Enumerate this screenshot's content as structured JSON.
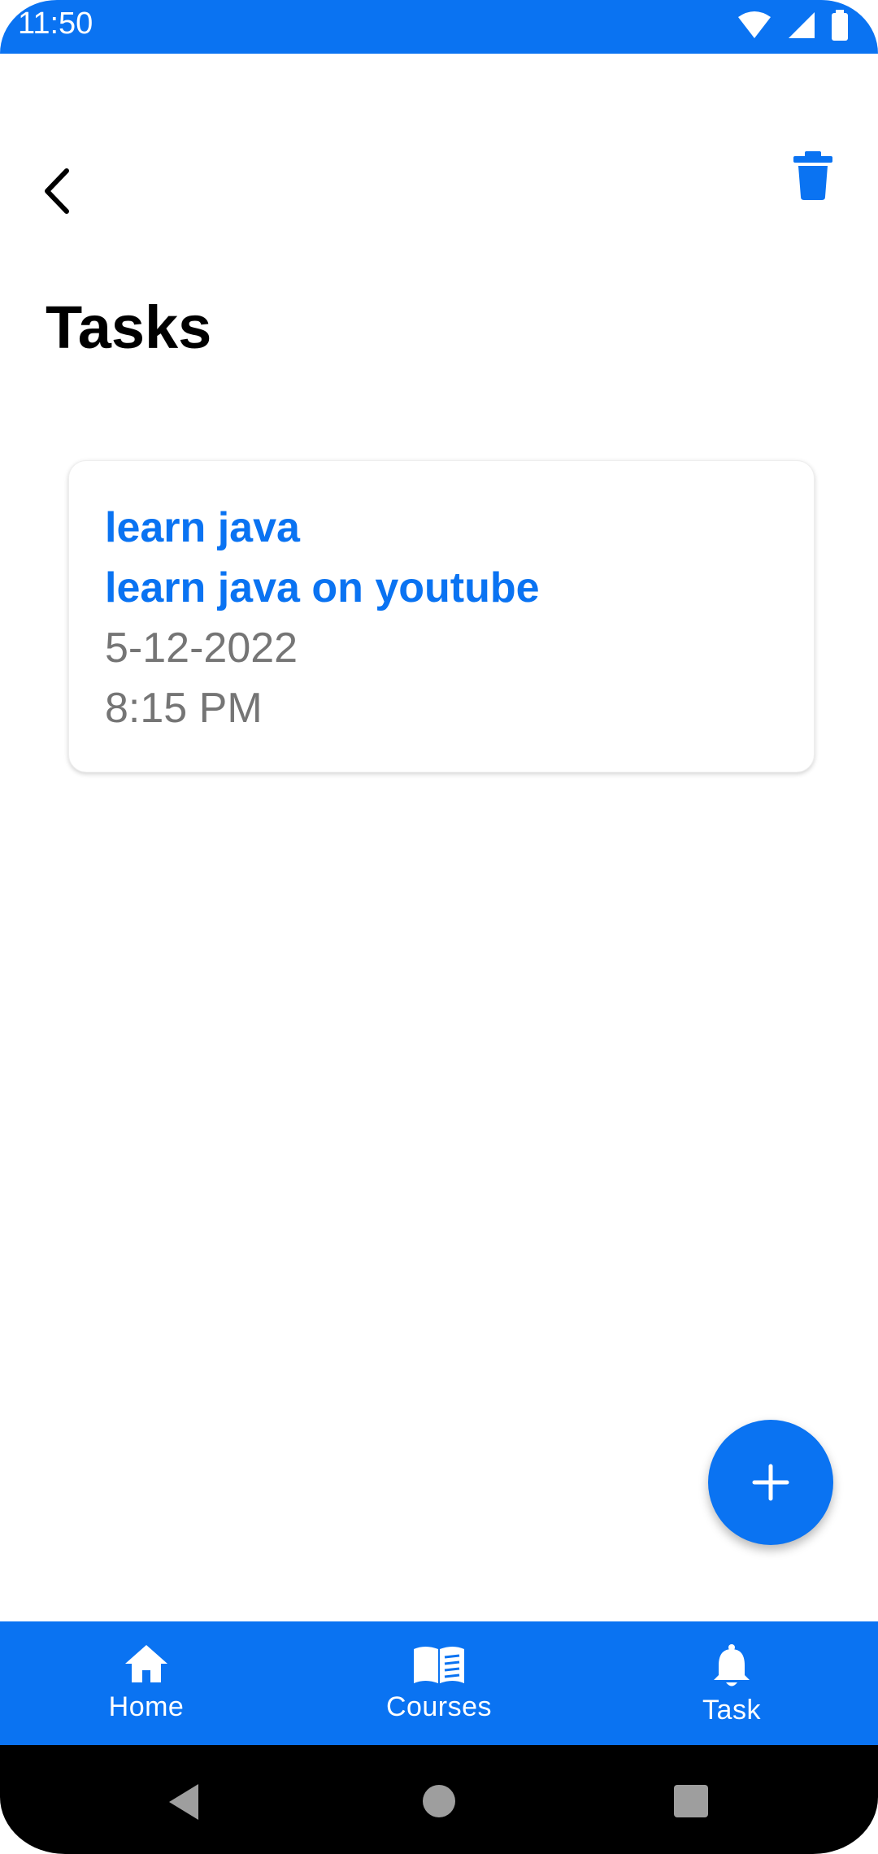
{
  "status_bar": {
    "time": "11:50"
  },
  "toolbar": {
    "title": "Tasks"
  },
  "tasks": [
    {
      "title": "learn java",
      "description": "learn java on youtube",
      "date": "5-12-2022",
      "time": "8:15 PM"
    }
  ],
  "bottom_nav": {
    "items": [
      {
        "label": "Home",
        "icon": "home-icon"
      },
      {
        "label": "Courses",
        "icon": "book-icon"
      },
      {
        "label": "Task",
        "icon": "bell-icon"
      }
    ]
  },
  "colors": {
    "accent": "#0a73f2",
    "secondary_text": "#757575",
    "background": "#ffffff"
  }
}
